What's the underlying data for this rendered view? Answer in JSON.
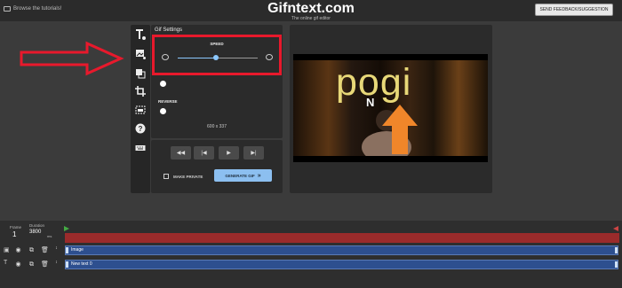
{
  "header": {
    "tutorial_link": "Browse the tutorials!",
    "brand": "Gifntext.com",
    "tagline": "The online gif editor",
    "feedback_button": "SEND FEEDBACK/SUGGESTION"
  },
  "toolbar": {
    "tools": [
      "add-text-icon",
      "add-image-icon",
      "layers-icon",
      "crop-icon",
      "gif-settings-icon",
      "help-icon",
      "keyboard-icon"
    ]
  },
  "settings": {
    "title": "Gif Settings",
    "speed_label": "SPEED",
    "speed_fraction": 0.48,
    "transparent_label": "TRANSPARENT",
    "reverse_label": "REVERSE",
    "dimensions": "600 x 337"
  },
  "player": {
    "make_private": "MAKE PRIVATE",
    "generate_button": "GENERATE GIF"
  },
  "preview": {
    "overlay_text": "pogi",
    "sub_text": "N"
  },
  "timeline": {
    "frame_label": "Frame",
    "frame_value": "1",
    "duration_label": "Duration",
    "duration_value": "3800",
    "duration_unit": "ms",
    "tracks": [
      {
        "name": "Image"
      },
      {
        "name": "New text 0"
      }
    ]
  },
  "colors": {
    "highlight": "#e8192c",
    "accent": "#8cbff0",
    "track": "#2d4f8f",
    "ruler": "#9a2b2b"
  }
}
